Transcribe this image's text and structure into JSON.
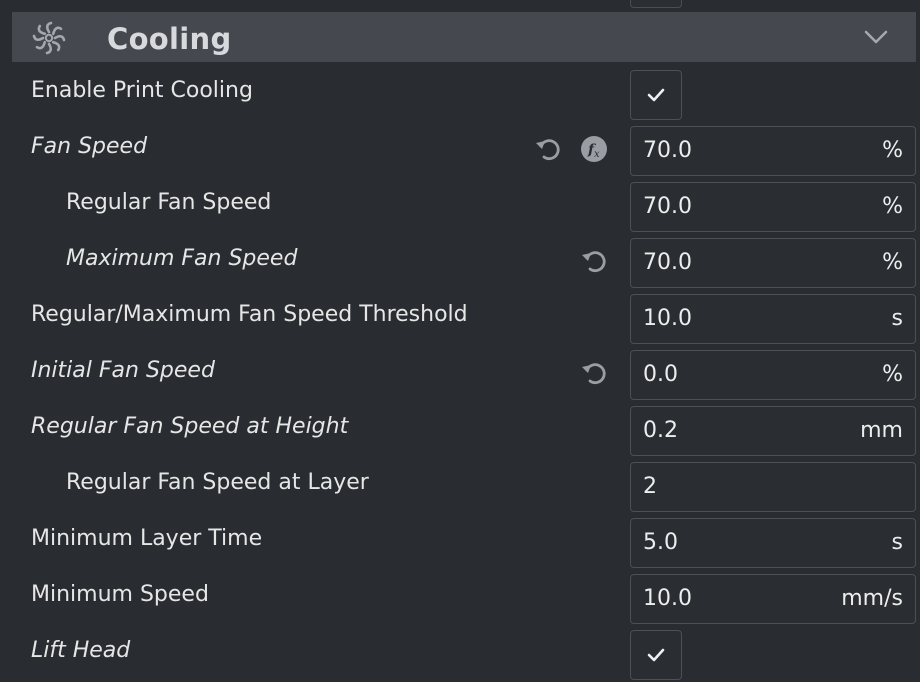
{
  "section": {
    "title": "Cooling",
    "icon": "fan-icon",
    "collapse_icon": "chevron-down-icon"
  },
  "settings": [
    {
      "label": "Enable Print Cooling",
      "type": "checkbox",
      "checked": true,
      "italic": false,
      "indent": 0
    },
    {
      "label": "Fan Speed",
      "type": "field",
      "value": "70.0",
      "unit": "%",
      "italic": true,
      "indent": 0,
      "reset": true,
      "function": true
    },
    {
      "label": "Regular Fan Speed",
      "type": "field",
      "value": "70.0",
      "unit": "%",
      "italic": false,
      "indent": 1
    },
    {
      "label": "Maximum Fan Speed",
      "type": "field",
      "value": "70.0",
      "unit": "%",
      "italic": true,
      "indent": 1,
      "reset": true
    },
    {
      "label": "Regular/Maximum Fan Speed Threshold",
      "type": "field",
      "value": "10.0",
      "unit": "s",
      "italic": false,
      "indent": 0
    },
    {
      "label": "Initial Fan Speed",
      "type": "field",
      "value": "0.0",
      "unit": "%",
      "italic": true,
      "indent": 0,
      "reset": true
    },
    {
      "label": "Regular Fan Speed at Height",
      "type": "field",
      "value": "0.2",
      "unit": "mm",
      "italic": true,
      "indent": 0
    },
    {
      "label": "Regular Fan Speed at Layer",
      "type": "field",
      "value": "2",
      "unit": "",
      "italic": false,
      "indent": 1
    },
    {
      "label": "Minimum Layer Time",
      "type": "field",
      "value": "5.0",
      "unit": "s",
      "italic": false,
      "indent": 0
    },
    {
      "label": "Minimum Speed",
      "type": "field",
      "value": "10.0",
      "unit": "mm/s",
      "italic": false,
      "indent": 0
    },
    {
      "label": "Lift Head",
      "type": "checkbox",
      "checked": true,
      "italic": true,
      "indent": 0
    }
  ],
  "colors": {
    "background": "#292c30",
    "header": "#45494f",
    "field_border": "#4c5057",
    "icon": "#9a9ea4"
  }
}
